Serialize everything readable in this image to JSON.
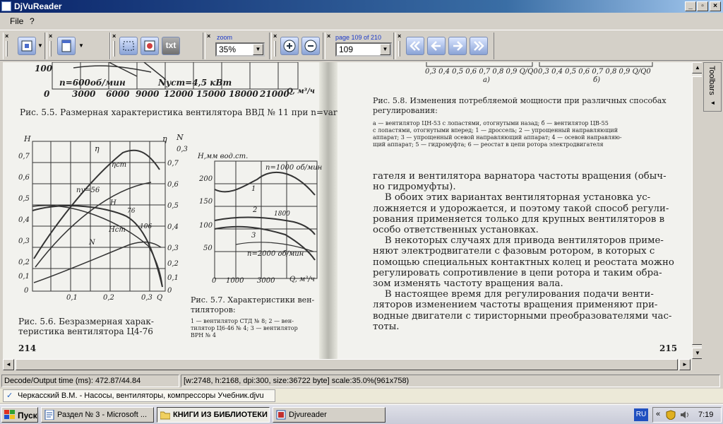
{
  "window": {
    "title": "DjVuReader",
    "min": "_",
    "max": "▫",
    "close": "×"
  },
  "menu": {
    "file": "File",
    "help": "?"
  },
  "toolbar": {
    "zoom_label": "zoom",
    "zoom_value": "35%",
    "page_label": "page 109 of 210",
    "page_value": "109",
    "text_button": "txt",
    "close_mark": "×"
  },
  "document": {
    "left_page": {
      "axis_top_x": [
        "0",
        "3000",
        "6000",
        "9000",
        "12000",
        "15000",
        "18000",
        "21000"
      ],
      "axis_top_y": "100",
      "axis_top_unit": "Q, м³/ч",
      "curve_label_n": "n=600об/мин",
      "curve_label_nust": "Nуст=4,5 кВт",
      "fig55": "Рис. 5.5. Размерная характеристика вентилятора ВВД № 11 при n=var",
      "fig56_yl_title": "H",
      "fig56_yl": [
        "0,7",
        "0,6",
        "0,5",
        "0,4",
        "0,3",
        "0,2",
        "0,1",
        "0"
      ],
      "fig56_yr_title": "η",
      "fig56_yr": [
        "0,3",
        "0,7",
        "0,6",
        "0,5",
        "0,4",
        "0,3",
        "0,2",
        "0,1",
        "0"
      ],
      "fig56_yr2_title": "N",
      "fig56_x": [
        "0,1",
        "0,2",
        "0,3"
      ],
      "fig56_x_title": "Q",
      "fig56_labels": [
        "η",
        "ηст",
        "ny=56",
        "H",
        "76",
        "Hст",
        "106",
        "N"
      ],
      "fig56_caption1": "Рис. 5.6. Безразмерная харак-",
      "fig56_caption2": "теристика вентилятора Ц4-76",
      "fig57_ytitle": "H,мм вод.ст.",
      "fig57_y": [
        "200",
        "150",
        "100",
        "50"
      ],
      "fig57_x": [
        "0",
        "1000",
        "3000",
        "Q, м³/ч"
      ],
      "fig57_labels": [
        "n=1000 об/мин",
        "1",
        "2",
        "1800",
        "3",
        "n=2000 об/мин"
      ],
      "fig57_caption1": "Рис. 5.7. Характеристики вен-",
      "fig57_caption2": "тиляторов:",
      "fig57_legend1": "1 — вентилятор СТД № 8; 2 — вен-",
      "fig57_legend2": "тилятор Ц6-46 № 4; 3 — вентилятор",
      "fig57_legend3": "ВРН № 4",
      "page_number": "214"
    },
    "right_page": {
      "axis_a": "0,3 0,4 0,5 0,6 0,7 0,8 0,9 Q/Q0",
      "axis_b": "0,3 0,4 0,5 0,6 0,7 0,8 0,9 Q/Q0",
      "label_a": "а)",
      "label_b": "б)",
      "fig58_caption1": "Рис. 5.8. Изменения потребляемой мощности при различных способах",
      "fig58_caption2": "регулирования:",
      "fig58_legend1": "а — вентилятор ЦН-53 с лопастями, отогнутыми назад; б — вентилятор ЦВ-55",
      "fig58_legend2": "с лопастями, отогнутыми вперед; 1 — дроссель; 2 — упрощенный направляющий",
      "fig58_legend3": "аппарат; 3 — упрощенный осевой направляющий аппарат; 4 — осевой направляю-",
      "fig58_legend4": "щий аппарат; 5 — гидромуфта; 6 — реостат в цепи ротора электродвигателя",
      "para": [
        "гателя и вентилятора варнатора частоты вращения (обыч-",
        "но гидромуфты).",
        "    В обоих этих вариантах вентиляторная установка ус-",
        "ложняется и удорожается, и поэтому такой способ регули-",
        "рования применяется только для крупных вентиляторов в",
        "особо ответственных установках.",
        "    В некоторых случаях для привода вентиляторов приме-",
        "няют электродвигатели с фазовым ротором, в которых с",
        "помощью специальных контактных колец и реостата можно",
        "регулировать сопротивление в цепи ротора и таким обра-",
        "зом изменять частоту вращения вала.",
        "    В настоящее время для регулирования подачи венти-",
        "ляторов изменением частоты вращения применяют при-",
        "водные двигатели с тиристорными преобразователями час-",
        "тоты."
      ],
      "page_number": "215"
    }
  },
  "sidepanel": {
    "toolbars_label": "Toolbars"
  },
  "status": {
    "decode": "Decode/Output time (ms): 472.87/44.84",
    "info": "[w:2748, h:2168, dpi:300, size:36722 byte] scale:35.0%(961x758)"
  },
  "docbar": {
    "file": "Черкасский В.М. - Насосы, вентиляторы, компрессоры Учебник.djvu"
  },
  "taskbar": {
    "start": "Пуск",
    "items": [
      "Раздел № 3 - Microsoft ...",
      "КНИГИ ИЗ БИБЛИОТЕКИ",
      "Djvureader"
    ],
    "lang": "RU",
    "time": "7:19"
  },
  "colors": {
    "title_start": "#0a246a",
    "title_end": "#a6caf0",
    "accent": "#1a38c8"
  }
}
